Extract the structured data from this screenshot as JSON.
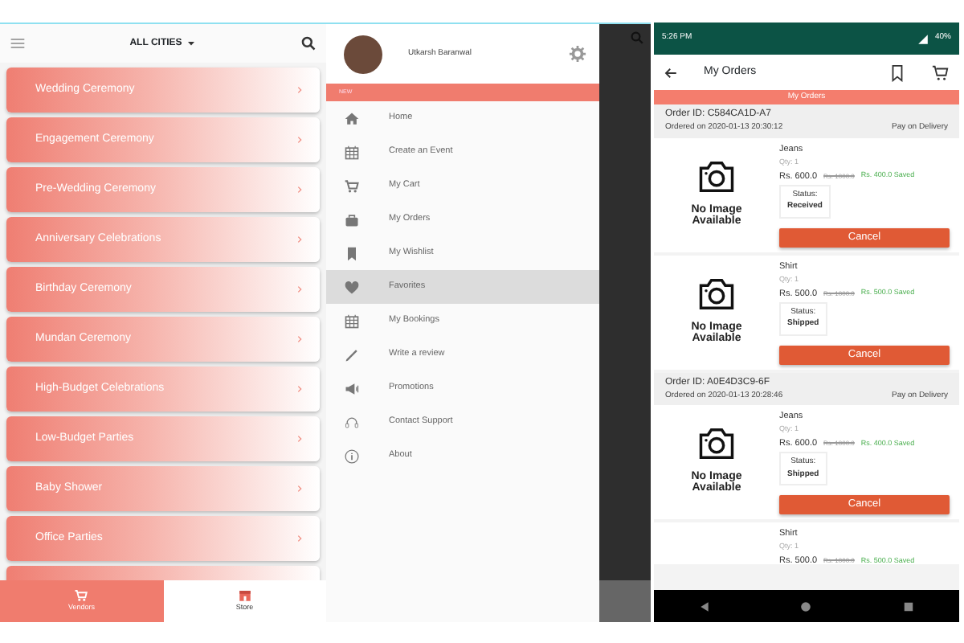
{
  "cities_screen": {
    "city_selector": "ALL CITIES",
    "categories": [
      "Wedding Ceremony",
      "Engagement Ceremony",
      "Pre-Wedding Ceremony",
      "Anniversary Celebrations",
      "Birthday Ceremony",
      "Mundan Ceremony",
      "High-Budget Celebrations",
      "Low-Budget Parties",
      "Baby Shower",
      "Office Parties"
    ],
    "bottom_nav": [
      {
        "label": "Vendors",
        "selected": true
      },
      {
        "label": "Store",
        "selected": false
      }
    ]
  },
  "drawer_screen": {
    "user_name": "Utkarsh Baranwal",
    "section_label": "NEW",
    "menu": [
      {
        "label": "Home",
        "selected": false
      },
      {
        "label": "Create an Event",
        "selected": false
      },
      {
        "label": "My Cart",
        "selected": false
      },
      {
        "label": "My Orders",
        "selected": false
      },
      {
        "label": "My Wishlist",
        "selected": false
      },
      {
        "label": "Favorites",
        "selected": true
      },
      {
        "label": "My Bookings",
        "selected": false
      },
      {
        "label": "Write a review",
        "selected": false
      },
      {
        "label": "Promotions",
        "selected": false
      },
      {
        "label": "Contact Support",
        "selected": false
      },
      {
        "label": "About",
        "selected": false
      }
    ]
  },
  "orders_screen": {
    "status_bar": {
      "time": "5:26 PM",
      "battery": "40%"
    },
    "title": "My Orders",
    "banner": "My Orders",
    "orders": [
      {
        "order_id": "Order ID: C584CA1D-A7",
        "ordered_on": "Ordered on 2020-01-13 20:30:12",
        "payment": "Pay on Delivery",
        "items": [
          {
            "image_text": "No Image Available",
            "name": "Jeans",
            "qty": "Qty: 1",
            "price": "Rs. 600.0",
            "original_price": "Rs. 1000.0",
            "saved": "Rs. 400.0 Saved",
            "status_label": "Status:",
            "status": "Received",
            "button": "Cancel"
          },
          {
            "image_text": "No Image Available",
            "name": "Shirt",
            "qty": "Qty: 1",
            "price": "Rs. 500.0",
            "original_price": "Rs. 1000.0",
            "saved": "Rs. 500.0 Saved",
            "status_label": "Status:",
            "status": "Shipped",
            "button": "Cancel"
          }
        ]
      },
      {
        "order_id": "Order ID: A0E4D3C9-6F",
        "ordered_on": "Ordered on 2020-01-13 20:28:46",
        "payment": "Pay on Delivery",
        "items": [
          {
            "image_text": "No Image Available",
            "name": "Jeans",
            "qty": "Qty: 1",
            "price": "Rs. 600.0",
            "original_price": "Rs. 1000.0",
            "saved": "Rs. 400.0 Saved",
            "status_label": "Status:",
            "status": "Shipped",
            "button": "Cancel"
          },
          {
            "name": "Shirt",
            "qty": "Qty: 1",
            "price": "Rs. 500.0",
            "original_price": "Rs. 1000.0",
            "saved": "Rs. 500.0 Saved"
          }
        ]
      }
    ]
  }
}
